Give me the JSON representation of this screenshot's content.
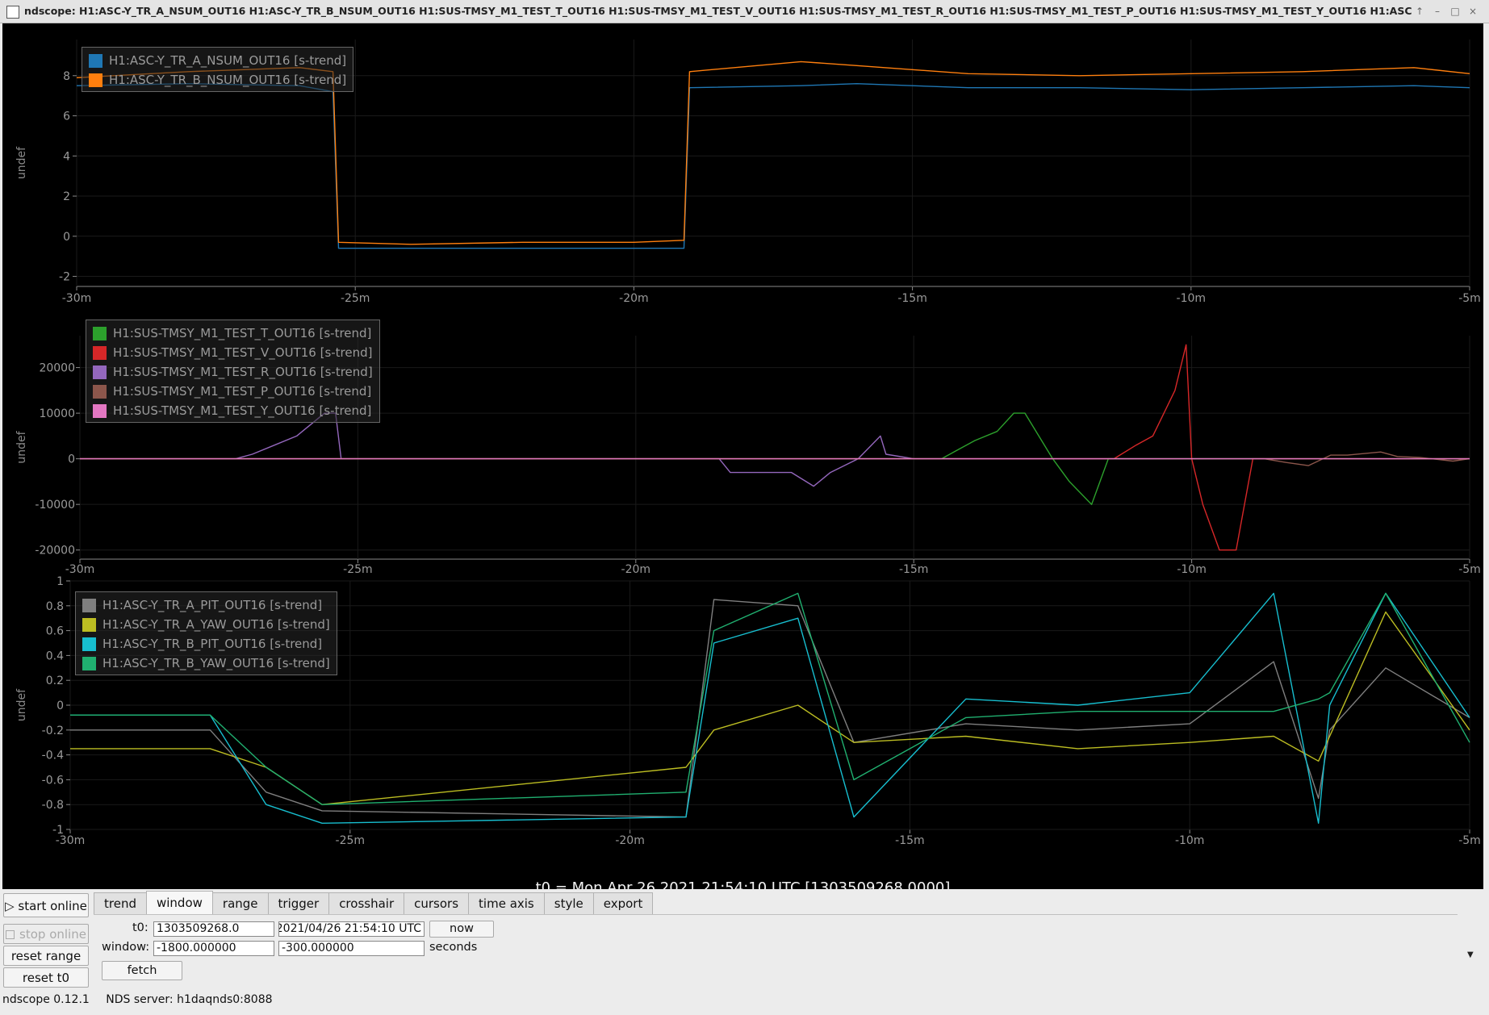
{
  "window": {
    "title": "ndscope: H1:ASC-Y_TR_A_NSUM_OUT16 H1:ASC-Y_TR_B_NSUM_OUT16 H1:SUS-TMSY_M1_TEST_T_OUT16 H1:SUS-TMSY_M1_TEST_V_OUT16 H1:SUS-TMSY_M1_TEST_R_OUT16 H1:SUS-TMSY_M1_TEST_P_OUT16 H1:SUS-TMSY_M1_TEST_Y_OUT16 H1:ASC",
    "controls": [
      "↑",
      "–",
      "□",
      "×"
    ]
  },
  "x_ticks": [
    "-30m",
    "-25m",
    "-20m",
    "-15m",
    "-10m",
    "-5m"
  ],
  "t0_label": "t0 = Mon Apr 26 2021 21:54:10 UTC [1303509268.0000]",
  "chart_data": [
    {
      "type": "line",
      "ylabel": "undef",
      "ylim": [
        -2.5,
        9.8
      ],
      "y_ticks": [
        "8",
        "6",
        "4",
        "2",
        "0",
        "-2"
      ],
      "legend": [
        {
          "label": "H1:ASC-Y_TR_A_NSUM_OUT16 [s-trend]",
          "color": "#1f77b4"
        },
        {
          "label": "H1:ASC-Y_TR_B_NSUM_OUT16 [s-trend]",
          "color": "#ff7f0e"
        }
      ],
      "series": [
        {
          "name": "H1:ASC-Y_TR_A_NSUM_OUT16 [s-trend]",
          "color": "#1f77b4",
          "x": [
            -30,
            -28,
            -26,
            -25.4,
            -25.3,
            -24,
            -22,
            -20,
            -19.1,
            -19,
            -17,
            -16,
            -14,
            -12,
            -10,
            -8,
            -6,
            -5
          ],
          "y": [
            7.5,
            7.6,
            7.5,
            7.2,
            -0.6,
            -0.6,
            -0.6,
            -0.6,
            -0.6,
            7.4,
            7.5,
            7.6,
            7.4,
            7.4,
            7.3,
            7.4,
            7.5,
            7.4
          ]
        },
        {
          "name": "H1:ASC-Y_TR_B_NSUM_OUT16 [s-trend]",
          "color": "#ff7f0e",
          "x": [
            -30,
            -28,
            -26,
            -25.4,
            -25.3,
            -24,
            -22,
            -20,
            -19.1,
            -19,
            -17,
            -16,
            -14,
            -12,
            -10,
            -8,
            -6,
            -5
          ],
          "y": [
            7.9,
            8.2,
            8.4,
            8.2,
            -0.3,
            -0.4,
            -0.3,
            -0.3,
            -0.2,
            8.2,
            8.7,
            8.5,
            8.1,
            8.0,
            8.1,
            8.2,
            8.4,
            8.1
          ]
        }
      ]
    },
    {
      "type": "line",
      "ylabel": "undef",
      "ylim": [
        -22000,
        27000
      ],
      "y_ticks": [
        "20000",
        "10000",
        "0",
        "-10000",
        "-20000"
      ],
      "legend": [
        {
          "label": "H1:SUS-TMSY_M1_TEST_T_OUT16 [s-trend]",
          "color": "#2ca02c"
        },
        {
          "label": "H1:SUS-TMSY_M1_TEST_V_OUT16 [s-trend]",
          "color": "#d62728"
        },
        {
          "label": "H1:SUS-TMSY_M1_TEST_R_OUT16 [s-trend]",
          "color": "#9467bd"
        },
        {
          "label": "H1:SUS-TMSY_M1_TEST_P_OUT16 [s-trend]",
          "color": "#8c564b"
        },
        {
          "label": "H1:SUS-TMSY_M1_TEST_Y_OUT16 [s-trend]",
          "color": "#e377c2"
        }
      ],
      "series": [
        {
          "name": "H1:SUS-TMSY_M1_TEST_R_OUT16 [s-trend]",
          "color": "#9467bd",
          "x": [
            -30,
            -27.2,
            -26.9,
            -26.5,
            -26.1,
            -25.6,
            -25.4,
            -25.3,
            -18.5,
            -18.3,
            -17.2,
            -16.8,
            -16.5,
            -16,
            -15.6,
            -15.5,
            -15,
            -5
          ],
          "y": [
            0,
            0,
            1000,
            3000,
            5000,
            10000,
            10000,
            0,
            0,
            -3000,
            -3000,
            -6000,
            -3000,
            0,
            5000,
            1000,
            0,
            0
          ]
        },
        {
          "name": "H1:SUS-TMSY_M1_TEST_T_OUT16 [s-trend]",
          "color": "#2ca02c",
          "x": [
            -30,
            -14.5,
            -14.2,
            -13.9,
            -13.5,
            -13.2,
            -13,
            -12.5,
            -12.2,
            -11.8,
            -11.5,
            -5
          ],
          "y": [
            0,
            0,
            2000,
            4000,
            6000,
            10000,
            10000,
            0,
            -5000,
            -10000,
            0,
            0
          ]
        },
        {
          "name": "H1:SUS-TMSY_M1_TEST_V_OUT16 [s-trend]",
          "color": "#d62728",
          "x": [
            -30,
            -11.4,
            -11,
            -10.7,
            -10.5,
            -10.3,
            -10.1,
            -10,
            -9.8,
            -9.5,
            -9.2,
            -8.9,
            -8.8,
            -5
          ],
          "y": [
            0,
            0,
            3000,
            5000,
            10000,
            15000,
            25000,
            0,
            -10000,
            -20000,
            -20000,
            0,
            0,
            0
          ]
        },
        {
          "name": "H1:SUS-TMSY_M1_TEST_P_OUT16 [s-trend]",
          "color": "#8c564b",
          "x": [
            -30,
            -8.7,
            -8.3,
            -7.9,
            -7.5,
            -7.2,
            -6.6,
            -6.3,
            -5.9,
            -5.3,
            -5
          ],
          "y": [
            0,
            0,
            -800,
            -1500,
            800,
            800,
            1500,
            500,
            300,
            -500,
            0
          ]
        },
        {
          "name": "H1:SUS-TMSY_M1_TEST_Y_OUT16 [s-trend]",
          "color": "#e377c2",
          "x": [
            -30,
            -5
          ],
          "y": [
            0,
            0
          ]
        }
      ]
    },
    {
      "type": "line",
      "ylabel": "undef",
      "ylim": [
        -1,
        1
      ],
      "y_ticks": [
        "1",
        "0.8",
        "0.6",
        "0.4",
        "0.2",
        "0",
        "-0.2",
        "-0.4",
        "-0.6",
        "-0.8",
        "-1"
      ],
      "legend": [
        {
          "label": "H1:ASC-Y_TR_A_PIT_OUT16 [s-trend]",
          "color": "#7f7f7f"
        },
        {
          "label": "H1:ASC-Y_TR_A_YAW_OUT16 [s-trend]",
          "color": "#bcbd22"
        },
        {
          "label": "H1:ASC-Y_TR_B_PIT_OUT16 [s-trend]",
          "color": "#17becf"
        },
        {
          "label": "H1:ASC-Y_TR_B_YAW_OUT16 [s-trend]",
          "color": "#20b070"
        }
      ],
      "series": [
        {
          "name": "H1:ASC-Y_TR_A_PIT_OUT16 [s-trend]",
          "color": "#7f7f7f",
          "x": [
            -30,
            -27.5,
            -26.5,
            -25.5,
            -19,
            -18.5,
            -17,
            -16,
            -14,
            -12,
            -10,
            -8.5,
            -7.7,
            -7.5,
            -6.5,
            -5
          ],
          "y": [
            -0.2,
            -0.2,
            -0.7,
            -0.85,
            -0.9,
            0.85,
            0.8,
            -0.3,
            -0.15,
            -0.2,
            -0.15,
            0.35,
            -0.75,
            -0.2,
            0.3,
            -0.1
          ]
        },
        {
          "name": "H1:ASC-Y_TR_A_YAW_OUT16 [s-trend]",
          "color": "#bcbd22",
          "x": [
            -30,
            -27.5,
            -26.5,
            -25.5,
            -19,
            -18.5,
            -17,
            -16,
            -14,
            -12,
            -10,
            -8.5,
            -7.7,
            -7.5,
            -6.5,
            -5
          ],
          "y": [
            -0.35,
            -0.35,
            -0.5,
            -0.8,
            -0.5,
            -0.2,
            0.0,
            -0.3,
            -0.25,
            -0.35,
            -0.3,
            -0.25,
            -0.45,
            -0.25,
            0.75,
            -0.2
          ]
        },
        {
          "name": "H1:ASC-Y_TR_B_PIT_OUT16 [s-trend]",
          "color": "#17becf",
          "x": [
            -30,
            -27.5,
            -26.5,
            -25.5,
            -19,
            -18.5,
            -17,
            -16,
            -14,
            -12,
            -10,
            -8.5,
            -7.7,
            -7.5,
            -6.5,
            -5
          ],
          "y": [
            -0.08,
            -0.08,
            -0.8,
            -0.95,
            -0.9,
            0.5,
            0.7,
            -0.9,
            0.05,
            0.0,
            0.1,
            0.9,
            -0.95,
            0.0,
            0.9,
            -0.1
          ]
        },
        {
          "name": "H1:ASC-Y_TR_B_YAW_OUT16 [s-trend]",
          "color": "#20b070",
          "x": [
            -30,
            -27.5,
            -26.5,
            -25.5,
            -19,
            -18.5,
            -17,
            -16,
            -14,
            -12,
            -10,
            -8.5,
            -7.7,
            -7.5,
            -6.5,
            -5
          ],
          "y": [
            -0.08,
            -0.08,
            -0.5,
            -0.8,
            -0.7,
            0.6,
            0.9,
            -0.6,
            -0.1,
            -0.05,
            -0.05,
            -0.05,
            0.05,
            0.1,
            0.9,
            -0.3
          ]
        }
      ]
    }
  ],
  "sidebar": {
    "start_online": "▷ start online",
    "stop_online": "stop online",
    "reset_range": "reset range",
    "reset_t0": "reset t0"
  },
  "tabs": [
    "trend",
    "window",
    "range",
    "trigger",
    "crosshair",
    "cursors",
    "time axis",
    "style",
    "export"
  ],
  "active_tab": "window",
  "window_panel": {
    "t0_label": "t0:",
    "t0_gps": "1303509268.0",
    "t0_utc": "2021/04/26 21:54:10 UTC",
    "now_button": "now",
    "window_label": "window:",
    "window_start": "-1800.000000",
    "window_end": "-300.000000",
    "seconds_label": "seconds",
    "fetch_button": "fetch"
  },
  "status": {
    "version": "ndscope 0.12.1",
    "nds_server": "NDS server: h1daqnds0:8088"
  }
}
